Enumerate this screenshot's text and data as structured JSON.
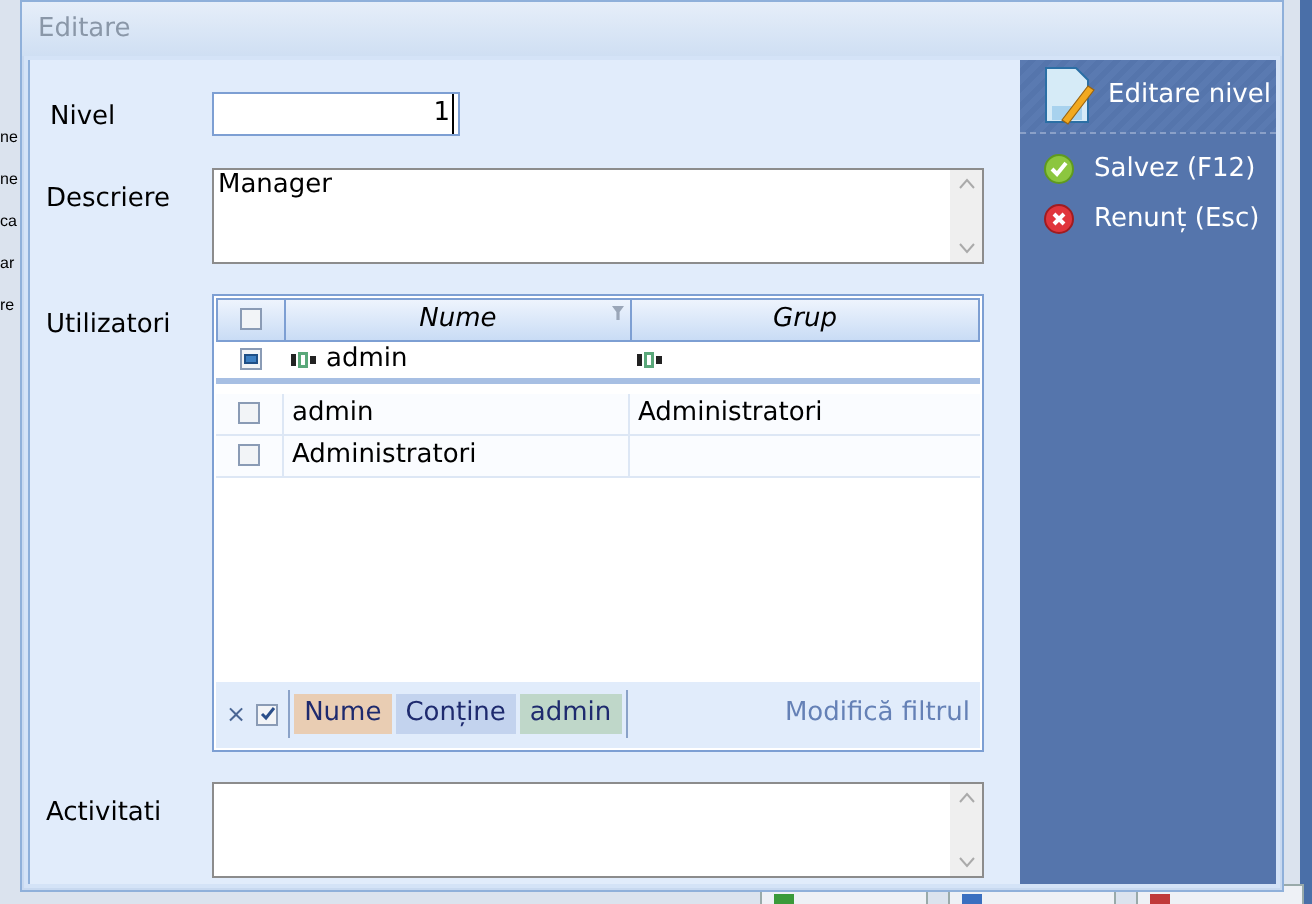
{
  "background": {
    "side_fragments": [
      "ne",
      "ne",
      "ca",
      "ar",
      "re"
    ],
    "buttons": [
      {
        "kind": "add"
      },
      {
        "kind": "edit"
      },
      {
        "kind": "delete"
      }
    ]
  },
  "dialog": {
    "title": "Editare",
    "fields": [
      {
        "label": "Nivel",
        "kind": "number",
        "value": "1"
      },
      {
        "label": "Descriere",
        "kind": "memo",
        "value": "Manager"
      },
      {
        "label": "Utilizatori",
        "kind": "grid"
      },
      {
        "label": "Activitati",
        "kind": "memo"
      }
    ],
    "grid": {
      "columns": [
        "Nume",
        "Grup"
      ],
      "all_checked": false,
      "filter_row": {
        "checked": true,
        "cells": [
          "admin",
          ""
        ]
      },
      "rows": [
        {
          "checked": false,
          "cells": [
            "admin",
            "Administratori"
          ]
        },
        {
          "checked": false,
          "cells": [
            "Administratori",
            ""
          ]
        }
      ],
      "filter_bar": {
        "enabled": true,
        "close": "×",
        "tokens": [
          {
            "text": "Nume",
            "color": "#e9cdb3"
          },
          {
            "text": "Conține",
            "color": "#c3d3ee"
          },
          {
            "text": "admin",
            "color": "#bfd7c9"
          }
        ],
        "link": "Modifică filtrul"
      }
    },
    "panel": {
      "title": "Editare nivel",
      "actions": [
        {
          "kind": "save",
          "label": "Salvez (F12)"
        },
        {
          "kind": "cancel",
          "label": "Renunț (Esc)"
        }
      ]
    }
  }
}
